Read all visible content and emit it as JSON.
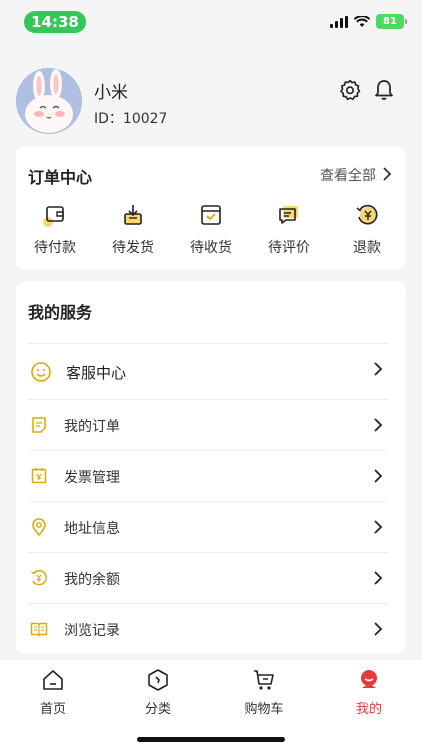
{
  "status_bar": {
    "time": "14:38",
    "battery": "81"
  },
  "profile": {
    "name": "小米",
    "id_text": "ID：10027"
  },
  "order_center": {
    "title": "订单中心",
    "view_all": "查看全部",
    "items": [
      {
        "label": "待付款",
        "icon": "wallet-icon"
      },
      {
        "label": "待发货",
        "icon": "package-icon"
      },
      {
        "label": "待收货",
        "icon": "receive-box-icon"
      },
      {
        "label": "待评价",
        "icon": "review-icon"
      },
      {
        "label": "退款",
        "icon": "refund-icon"
      }
    ]
  },
  "services": {
    "title": "我的服务",
    "items": [
      {
        "label": "客服中心",
        "icon": "smiley-icon"
      },
      {
        "label": "我的订单",
        "icon": "order-doc-icon"
      },
      {
        "label": "发票管理",
        "icon": "invoice-icon"
      },
      {
        "label": "地址信息",
        "icon": "location-pin-icon"
      },
      {
        "label": "我的余额",
        "icon": "balance-icon"
      },
      {
        "label": "浏览记录",
        "icon": "book-icon"
      }
    ]
  },
  "tabs": [
    {
      "label": "首页",
      "icon": "home-icon"
    },
    {
      "label": "分类",
      "icon": "category-icon"
    },
    {
      "label": "购物车",
      "icon": "cart-icon"
    },
    {
      "label": "我的",
      "icon": "profile-icon"
    }
  ],
  "colors": {
    "accent": "#f5c518",
    "active_tab": "#e83a3a",
    "status_green": "#34c759"
  }
}
